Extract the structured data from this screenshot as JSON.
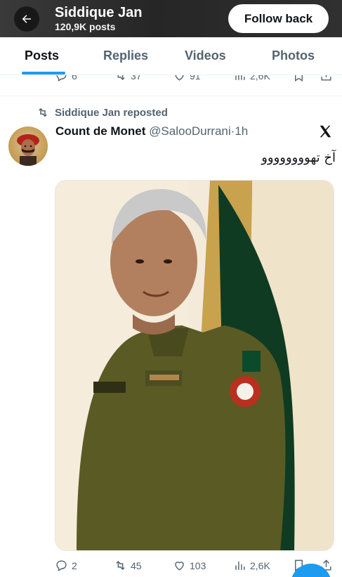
{
  "header": {
    "name": "Siddique Jan",
    "post_count": "120,9K posts",
    "follow_label": "Follow back"
  },
  "tabs": [
    {
      "label": "Posts",
      "active": true
    },
    {
      "label": "Replies",
      "active": false
    },
    {
      "label": "Videos",
      "active": false
    },
    {
      "label": "Photos",
      "active": false
    }
  ],
  "previous_post_actions": {
    "replies": "6",
    "reposts": "37",
    "likes": "91",
    "views": "2,6K"
  },
  "post": {
    "repost_label": "Siddique Jan reposted",
    "author_name": "Count de Monet",
    "author_handle": "@SalooDurrani",
    "separator": "·",
    "time": "1h",
    "text": "آخ تھوووووووو",
    "actions": {
      "replies": "2",
      "reposts": "45",
      "likes": "103",
      "views": "2,6K"
    }
  },
  "colors": {
    "accent": "#1d9bf0",
    "text_primary": "#0f1419",
    "text_secondary": "#536471",
    "uniform": "#5a5a25"
  },
  "icons": [
    "back-arrow-icon",
    "reply-icon",
    "repost-icon",
    "like-icon",
    "views-icon",
    "bookmark-icon",
    "share-icon",
    "x-logo-icon"
  ]
}
